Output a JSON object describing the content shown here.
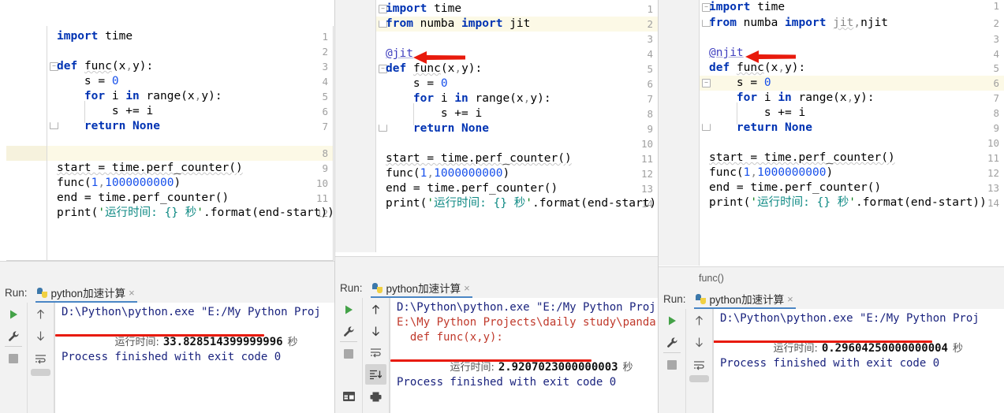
{
  "app": {
    "name": "PyCharm",
    "accent_blue": "#4a86c5",
    "arrow_red": "#e81a0c",
    "underline_red": "#e81a0c",
    "highlight_row": "#fcf9e6"
  },
  "panels": [
    {
      "id": "left",
      "editor": {
        "line_numbers": [
          "1",
          "2",
          "3",
          "4",
          "5",
          "6",
          "7",
          "8",
          "9",
          "10",
          "11",
          "12"
        ],
        "highlighted_line": 8,
        "lines": [
          "import time",
          "",
          "def func(x,y):",
          "    s = 0",
          "    for i in range(x,y):",
          "        s += i",
          "    return None",
          "",
          "start = time.perf_counter()",
          "func(1,1000000000)",
          "end = time.perf_counter()",
          "print('运行时间: {} 秒'.format(end-start))"
        ]
      },
      "breadcrumb": "",
      "run": {
        "label": "Run:",
        "tab_title": "python加速计算",
        "tab_icon": "python-logo-icon",
        "close_icon": "×",
        "toolbar_icons": [
          "run-icon",
          "wrench-icon",
          "stop-icon"
        ],
        "toolbar2_icons": [
          "arrow-up-icon",
          "arrow-down-icon",
          "soft-wrap-icon"
        ],
        "console_lines": [
          {
            "kind": "blue",
            "text": "D:\\Python\\python.exe \"E:/My Python Proj"
          },
          {
            "kind": "result",
            "prefix": "运行时间:",
            "value": "33.828514399999996",
            "suffix": "秒",
            "underlined": true
          },
          {
            "kind": "blank",
            "text": ""
          },
          {
            "kind": "blue",
            "text": "Process finished with exit code 0"
          }
        ]
      }
    },
    {
      "id": "middle",
      "editor": {
        "line_numbers": [
          "1",
          "2",
          "3",
          "4",
          "5",
          "6",
          "7",
          "8",
          "9",
          "10",
          "11",
          "12",
          "13",
          "14"
        ],
        "highlighted_line": 2,
        "lines": [
          "import time",
          "from numba import jit",
          "",
          "@jit",
          "def func(x,y):",
          "    s = 0",
          "    for i in range(x,y):",
          "        s += i",
          "    return None",
          "",
          "start = time.perf_counter()",
          "func(1,1000000000)",
          "end = time.perf_counter()",
          "print('运行时间: {} 秒'.format(end-start))"
        ],
        "annotation_arrow": {
          "points_to_line": 4,
          "points_to_text": "@jit",
          "color": "#e81a0c"
        }
      },
      "breadcrumb": "",
      "run": {
        "label": "Run:",
        "tab_title": "python加速计算",
        "tab_icon": "python-logo-icon",
        "close_icon": "×",
        "toolbar_icons": [
          "run-icon",
          "wrench-icon",
          "stop-icon",
          "layout-icon"
        ],
        "toolbar2_icons": [
          "arrow-up-icon",
          "arrow-down-icon",
          "soft-wrap-icon",
          "scroll-to-end-icon",
          "print-icon"
        ],
        "console_lines": [
          {
            "kind": "blue",
            "text": "D:\\Python\\python.exe \"E:/My Python Proj"
          },
          {
            "kind": "red",
            "text": "E:\\My Python Projects\\daily study\\panda"
          },
          {
            "kind": "red",
            "text": "  def func(x,y):"
          },
          {
            "kind": "result",
            "prefix": "运行时间:",
            "value": "2.9207023000000003",
            "suffix": "秒",
            "underlined": true
          },
          {
            "kind": "blank",
            "text": ""
          },
          {
            "kind": "blue",
            "text": "Process finished with exit code 0"
          }
        ]
      }
    },
    {
      "id": "right",
      "editor": {
        "line_numbers": [
          "1",
          "2",
          "3",
          "4",
          "5",
          "6",
          "7",
          "8",
          "9",
          "10",
          "11",
          "12",
          "13",
          "14"
        ],
        "highlighted_line": 5,
        "lines": [
          "import time",
          "from numba import jit,njit",
          "",
          "@njit",
          "def func(x,y):",
          "    s = 0",
          "    for i in range(x,y):",
          "        s += i",
          "    return None",
          "",
          "start = time.perf_counter()",
          "func(1,1000000000)",
          "end = time.perf_counter()",
          "print('运行时间: {} 秒'.format(end-start))"
        ],
        "annotation_arrow": {
          "points_to_line": 4,
          "points_to_text": "@njit",
          "color": "#e81a0c"
        }
      },
      "breadcrumb": "func()",
      "run": {
        "label": "Run:",
        "tab_title": "python加速计算",
        "tab_icon": "python-logo-icon",
        "close_icon": "×",
        "toolbar_icons": [
          "run-icon",
          "wrench-icon",
          "stop-icon"
        ],
        "toolbar2_icons": [
          "arrow-up-icon",
          "arrow-down-icon",
          "soft-wrap-icon"
        ],
        "console_lines": [
          {
            "kind": "blue",
            "text": "D:\\Python\\python.exe \"E:/My Python Proj"
          },
          {
            "kind": "result",
            "prefix": "运行时间:",
            "value": "0.29604250000000004",
            "suffix": "秒",
            "underlined": true
          },
          {
            "kind": "blank",
            "text": ""
          },
          {
            "kind": "blue",
            "text": "Process finished with exit code 0"
          }
        ]
      }
    }
  ]
}
